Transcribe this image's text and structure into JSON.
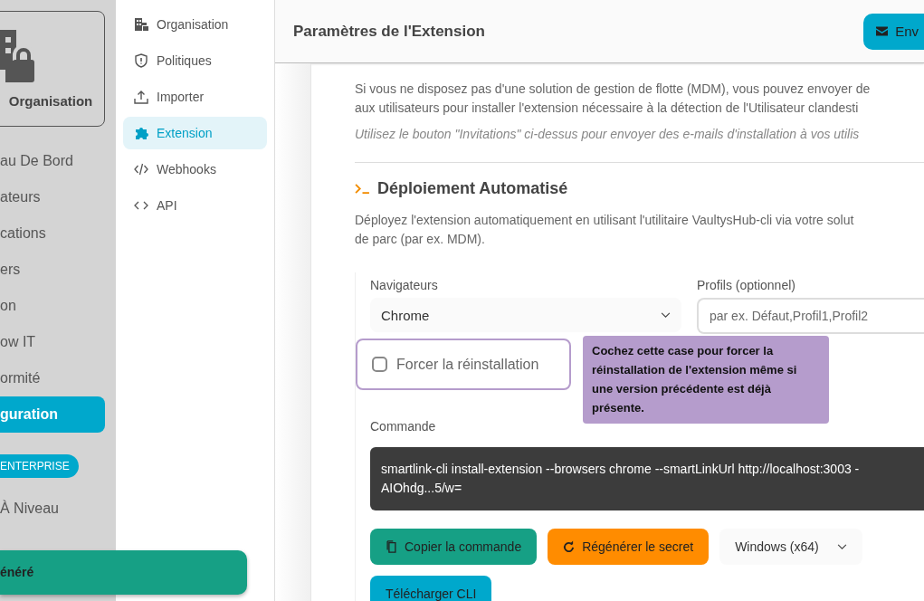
{
  "sidebar": {
    "org_card": {
      "label": "Organisation"
    },
    "items": [
      {
        "label": "au De Bord",
        "selected": false
      },
      {
        "label": "ateurs",
        "selected": false
      },
      {
        "label": "cations",
        "selected": false
      },
      {
        "label": "ers",
        "selected": false
      },
      {
        "label": "on",
        "selected": false
      },
      {
        "label": "ow IT",
        "selected": false
      },
      {
        "label": "ormité",
        "selected": false
      },
      {
        "label": "guration",
        "selected": true
      }
    ],
    "badge": "ENTERPRISE",
    "upgrade": "À Niveau"
  },
  "subnav": {
    "items": [
      {
        "label": "Organisation",
        "kind": "building",
        "selected": false
      },
      {
        "label": "Politiques",
        "kind": "shield",
        "selected": false
      },
      {
        "label": "Importer",
        "kind": "upload",
        "selected": false
      },
      {
        "label": "Extension",
        "kind": "puzzle",
        "selected": true
      },
      {
        "label": "Webhooks",
        "kind": "code-slash",
        "selected": false
      },
      {
        "label": "API",
        "kind": "code",
        "selected": false
      }
    ]
  },
  "header": {
    "title": "Paramètres de l'Extension",
    "button": "Env"
  },
  "intro": {
    "lines": [
      "Si vous ne disposez pas d'une solution de gestion de flotte (MDM), vous pouvez envoyer de",
      "aux utilisateurs pour installer l'extension nécessaire à la détection de l'Utilisateur clandesti"
    ],
    "note": "Utilisez le bouton \"Invitations\" ci-dessus pour envoyer des e-mails d'installation à vos utilis"
  },
  "deploy": {
    "title": "Déploiement Automatisé",
    "lines": [
      "Déployez l'extension automatiquement en utilisant l'utilitaire VaultysHub-cli via votre solut",
      "de parc (par ex. MDM)."
    ]
  },
  "form": {
    "browsers": {
      "label": "Navigateurs",
      "value": "Chrome"
    },
    "profiles": {
      "label": "Profils (optionnel)",
      "placeholder": "par ex. Défaut,Profil1,Profil2"
    },
    "force": {
      "label": "Forcer la réinstallation",
      "checked": false
    },
    "tooltip": "Cochez cette case pour forcer la réinstallation de l'extension même si une version précédente est déjà présente.",
    "command": {
      "label": "Commande",
      "lines": [
        "smartlink-cli install-extension --browsers chrome --smartLinkUrl http://localhost:3003 -",
        "AIOhdg...5/w="
      ]
    },
    "actions": [
      {
        "kind": "copy",
        "label": "Copier la commande"
      },
      {
        "kind": "regenerate",
        "label": "Régénérer le secret"
      },
      {
        "kind": "select",
        "label": "Windows (x64)"
      }
    ],
    "download": {
      "label": "Télécharger CLI"
    }
  },
  "toast": "énéré"
}
